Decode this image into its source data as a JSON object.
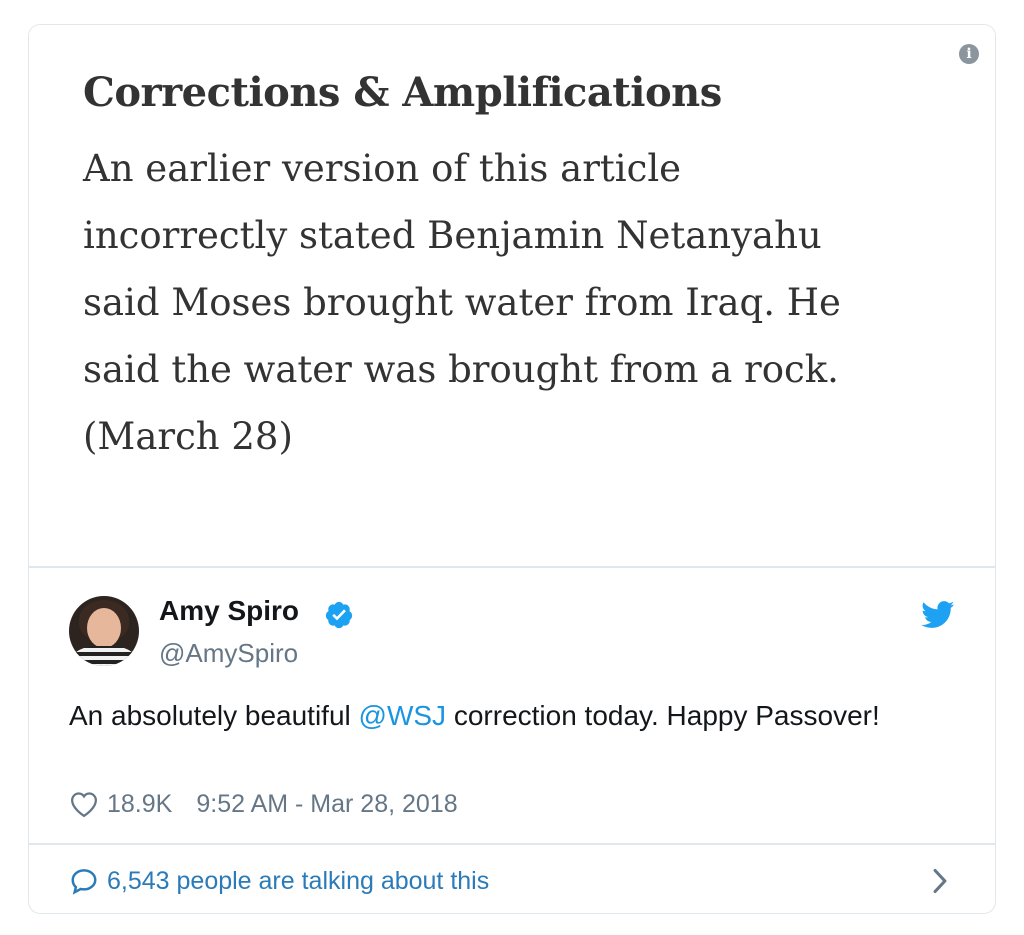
{
  "media": {
    "info_icon_glyph": "i",
    "correction_title": "Corrections & Amplifications",
    "correction_lines": [
      "An earlier version of this article",
      "incorrectly stated Benjamin Netanyahu",
      "said Moses brought water from Iraq. He",
      "said the water was brought from a rock.",
      "(March 28)"
    ]
  },
  "author": {
    "name": "Amy Spiro",
    "handle": "@AmySpiro",
    "verified": true
  },
  "tweet": {
    "text_before": "An absolutely beautiful ",
    "mention": "@WSJ",
    "text_after": " correction today. Happy Passover!",
    "likes": "18.9K",
    "timestamp": "9:52 AM - Mar 28, 2018"
  },
  "footer": {
    "talking_text": "6,543 people are talking about this"
  },
  "icons": {
    "info": "info-icon",
    "verified": "verified-badge-icon",
    "brand": "twitter-bird-icon",
    "like": "heart-icon",
    "reply": "speech-bubble-icon",
    "more": "chevron-right-icon"
  },
  "colors": {
    "link": "#1b95e0",
    "twitter_blue": "#1da1f2",
    "muted": "#657786",
    "border": "#e1e8ed"
  }
}
